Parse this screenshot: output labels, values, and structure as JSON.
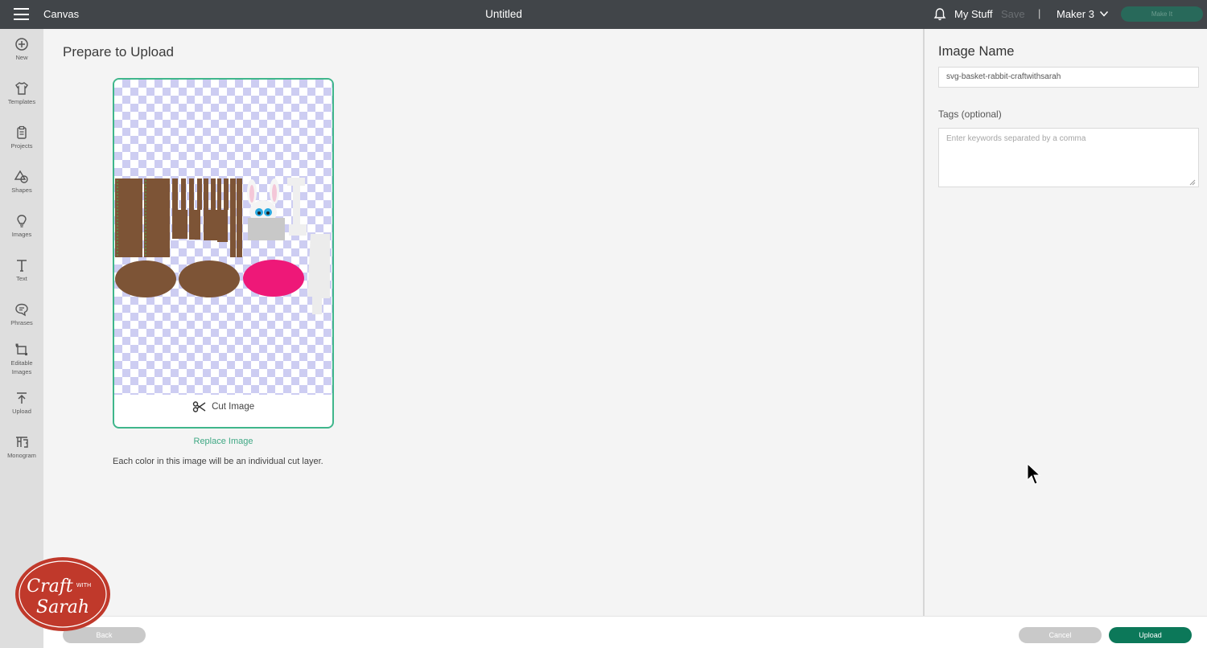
{
  "topbar": {
    "menu_icon": "hamburger-icon",
    "app_title": "Canvas",
    "document_title": "Untitled",
    "notifications_icon": "bell-icon",
    "my_stuff": "My Stuff",
    "save": "Save",
    "separator": "|",
    "machine": "Maker 3",
    "machine_icon": "chevron-down-icon",
    "make_it": "Make It"
  },
  "sidebar": {
    "items": [
      {
        "label": "New",
        "icon": "plus-circle-icon"
      },
      {
        "label": "Templates",
        "icon": "shirt-icon"
      },
      {
        "label": "Projects",
        "icon": "clipboard-icon"
      },
      {
        "label": "Shapes",
        "icon": "shapes-icon"
      },
      {
        "label": "Images",
        "icon": "lightbulb-icon"
      },
      {
        "label": "Text",
        "icon": "text-icon"
      },
      {
        "label": "Phrases",
        "icon": "speech-bubble-icon"
      },
      {
        "label": "Editable Images",
        "icon": "editable-image-icon"
      },
      {
        "label": "Upload",
        "icon": "upload-icon"
      },
      {
        "label": "Monogram",
        "icon": "monogram-icon"
      }
    ]
  },
  "main": {
    "title": "Prepare to Upload",
    "cut_image": "Cut Image",
    "cut_icon": "scissors-icon",
    "replace_image": "Replace Image",
    "note": "Each color in this image will be an individual cut layer."
  },
  "panel": {
    "image_name_title": "Image Name",
    "image_name_value": "svg-basket-rabbit-craftwithsarah",
    "tags_label": "Tags (optional)",
    "tags_placeholder": "Enter keywords separated by a comma"
  },
  "footer": {
    "back": "Back",
    "cancel": "Cancel",
    "upload": "Upload"
  },
  "watermark": {
    "line1": "Craft",
    "line2": "with",
    "line3": "Sarah"
  },
  "colors": {
    "topbar": "#414549",
    "accent": "#3fb68b",
    "upload_button": "#0c7859",
    "brown": "#7d5436",
    "pink": "#ee1878",
    "logo_red": "#c0392b"
  }
}
